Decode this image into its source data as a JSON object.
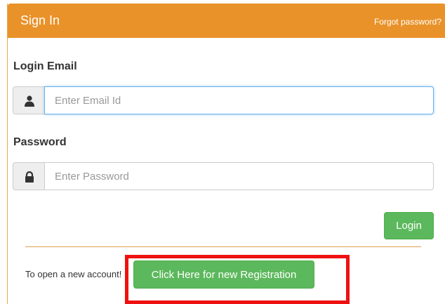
{
  "header": {
    "title": "Sign In",
    "forgot_password": "Forgot password?",
    "color": "#e99229"
  },
  "form": {
    "email": {
      "label": "Login Email",
      "placeholder": "Enter Email Id",
      "icon": "user-icon"
    },
    "password": {
      "label": "Password",
      "placeholder": "Enter Password",
      "icon": "lock-icon"
    },
    "login_label": "Login"
  },
  "registration": {
    "prompt": "To open a new account!",
    "button_label": "Click Here for new Registration",
    "button_color": "#5cb85c",
    "highlight_color": "#ee1111"
  }
}
